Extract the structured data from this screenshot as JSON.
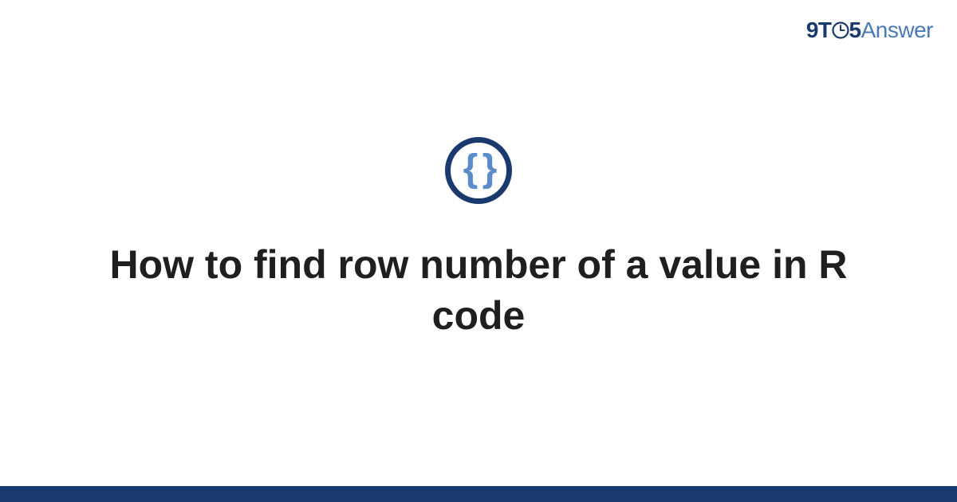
{
  "brand": {
    "prefix": "9T",
    "num5": "5",
    "suffix": "Answer"
  },
  "icon": {
    "braces": "{ }"
  },
  "title": "How to find row number of a value in R code",
  "colors": {
    "darkBlue": "#1a3a6e",
    "lightBlue": "#4a7ab8",
    "braceBlue": "#5a8cc9"
  }
}
